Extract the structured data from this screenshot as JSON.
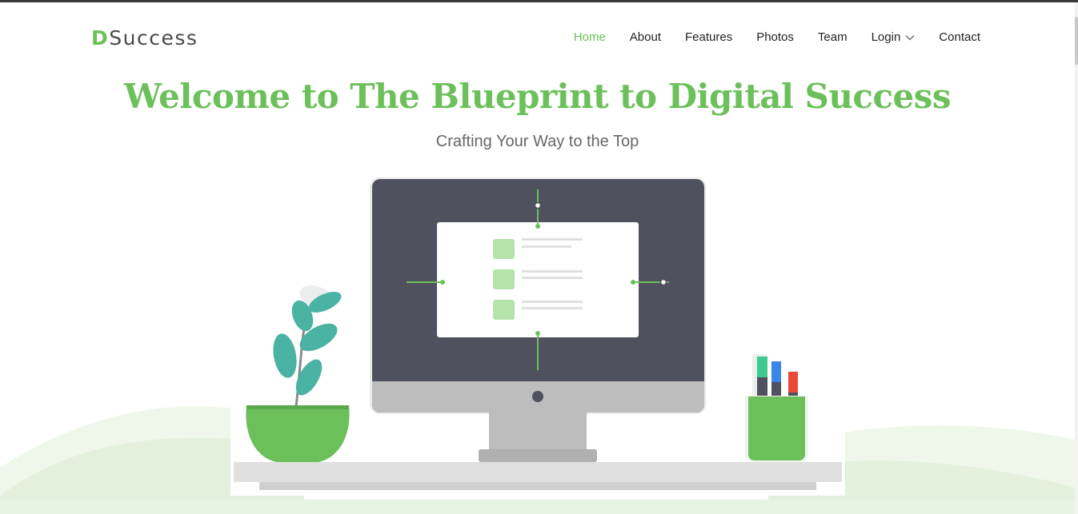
{
  "brand": {
    "first_letter": "D",
    "rest": "Success"
  },
  "nav": {
    "items": [
      {
        "label": "Home",
        "active": true
      },
      {
        "label": "About"
      },
      {
        "label": "Features"
      },
      {
        "label": "Photos"
      },
      {
        "label": "Team"
      },
      {
        "label": "Login",
        "dropdown": true
      },
      {
        "label": "Contact"
      }
    ]
  },
  "hero": {
    "title": "Welcome to The Blueprint to Digital Success",
    "subtitle": "Crafting Your Way to the Top"
  },
  "icons": {
    "login_dropdown": "chevron-down-icon"
  },
  "colors": {
    "accent": "#6cc05a",
    "monitor": "#50515e",
    "plant_leaf": "#4ab3a3",
    "hill": "#e6f3e0"
  }
}
